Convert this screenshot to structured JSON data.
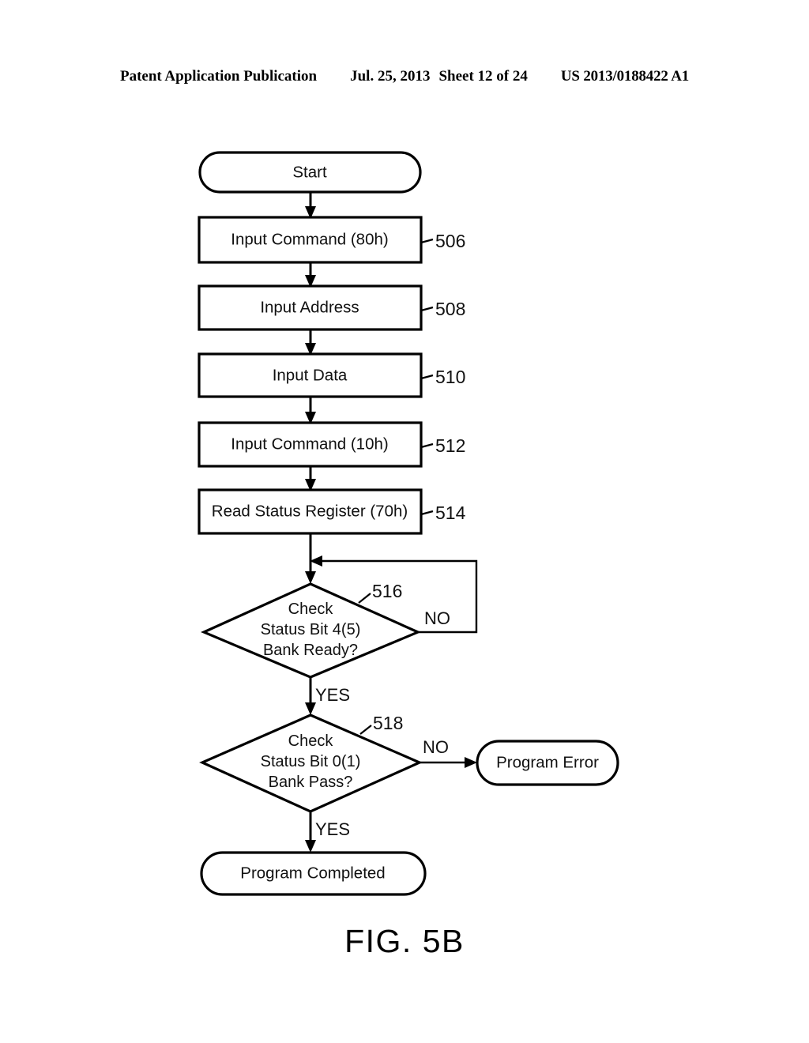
{
  "header": {
    "publication": "Patent Application Publication",
    "date": "Jul. 25, 2013",
    "sheet": "Sheet 12 of 24",
    "patent_number": "US 2013/0188422 A1"
  },
  "figure": {
    "caption": "FIG. 5B"
  },
  "chart_data": {
    "type": "diagram",
    "title": "FIG. 5B",
    "nodes": [
      {
        "id": "start",
        "kind": "terminal",
        "label": "Start",
        "ref": ""
      },
      {
        "id": "n506",
        "kind": "process",
        "label": "Input Command (80h)",
        "ref": "506"
      },
      {
        "id": "n508",
        "kind": "process",
        "label": "Input Address",
        "ref": "508"
      },
      {
        "id": "n510",
        "kind": "process",
        "label": "Input Data",
        "ref": "510"
      },
      {
        "id": "n512",
        "kind": "process",
        "label": "Input Command (10h)",
        "ref": "512"
      },
      {
        "id": "n514",
        "kind": "process",
        "label": "Read Status Register (70h)",
        "ref": "514"
      },
      {
        "id": "n516",
        "kind": "decision",
        "label": "Check Status Bit 4(5) Bank Ready?",
        "ref": "516",
        "lines": [
          "Check",
          "Status Bit 4(5)",
          "Bank Ready?"
        ]
      },
      {
        "id": "n518",
        "kind": "decision",
        "label": "Check Status Bit 0(1) Bank Pass?",
        "ref": "518",
        "lines": [
          "Check",
          "Status Bit 0(1)",
          "Bank Pass?"
        ]
      },
      {
        "id": "error",
        "kind": "terminal",
        "label": "Program Error",
        "ref": ""
      },
      {
        "id": "done",
        "kind": "terminal",
        "label": "Program Completed",
        "ref": ""
      }
    ],
    "edges": [
      {
        "from": "start",
        "to": "n506",
        "label": ""
      },
      {
        "from": "n506",
        "to": "n508",
        "label": ""
      },
      {
        "from": "n508",
        "to": "n510",
        "label": ""
      },
      {
        "from": "n510",
        "to": "n512",
        "label": ""
      },
      {
        "from": "n512",
        "to": "n514",
        "label": ""
      },
      {
        "from": "n514",
        "to": "n516",
        "label": ""
      },
      {
        "from": "n516",
        "to": "n516",
        "label": "NO"
      },
      {
        "from": "n516",
        "to": "n518",
        "label": "YES"
      },
      {
        "from": "n518",
        "to": "error",
        "label": "NO"
      },
      {
        "from": "n518",
        "to": "done",
        "label": "YES"
      }
    ],
    "branch_labels": {
      "d516_no": "NO",
      "d516_yes": "YES",
      "d518_no": "NO",
      "d518_yes": "YES"
    },
    "refs": {
      "r506": "506",
      "r508": "508",
      "r510": "510",
      "r512": "512",
      "r514": "514",
      "r516": "516",
      "r518": "518"
    },
    "labels": {
      "start": "Start",
      "n506": "Input Command (80h)",
      "n508": "Input Address",
      "n510": "Input Data",
      "n512": "Input Command (10h)",
      "n514": "Read Status Register (70h)",
      "n516_l1": "Check",
      "n516_l2": "Status Bit 4(5)",
      "n516_l3": "Bank Ready?",
      "n518_l1": "Check",
      "n518_l2": "Status Bit 0(1)",
      "n518_l3": "Bank Pass?",
      "error": "Program Error",
      "done": "Program Completed"
    },
    "colors": {
      "ink": "#000000",
      "paper": "#ffffff"
    }
  }
}
